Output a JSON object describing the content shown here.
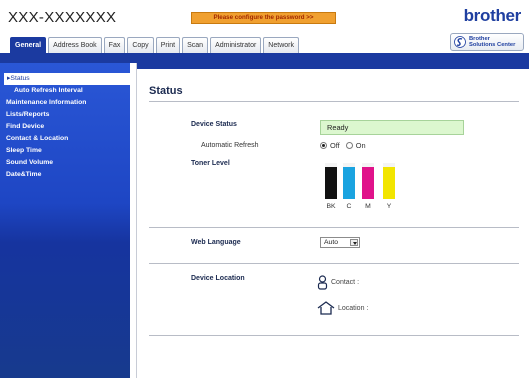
{
  "header": {
    "model": "XXX-XXXXXXX",
    "warning": "Please configure the password >>",
    "brand": "brother"
  },
  "tabs": [
    {
      "label": "General",
      "active": true
    },
    {
      "label": "Address Book",
      "active": false
    },
    {
      "label": "Fax",
      "active": false
    },
    {
      "label": "Copy",
      "active": false
    },
    {
      "label": "Print",
      "active": false
    },
    {
      "label": "Scan",
      "active": false
    },
    {
      "label": "Administrator",
      "active": false
    },
    {
      "label": "Network",
      "active": false
    }
  ],
  "solutions_center": {
    "line1": "Brother",
    "line2": "Solutions Center"
  },
  "sidebar": {
    "items": [
      {
        "label": "Status"
      },
      {
        "label": "Auto Refresh Interval"
      },
      {
        "label": "Maintenance Information"
      },
      {
        "label": "Lists/Reports"
      },
      {
        "label": "Find Device"
      },
      {
        "label": "Contact & Location"
      },
      {
        "label": "Sleep Time"
      },
      {
        "label": "Sound Volume"
      },
      {
        "label": "Date&Time"
      }
    ]
  },
  "main": {
    "title": "Status",
    "device_status_label": "Device Status",
    "device_status_value": "Ready",
    "auto_refresh_label": "Automatic Refresh",
    "auto_refresh_options": [
      "Off",
      "On"
    ],
    "auto_refresh_selected": "Off",
    "toner_label": "Toner Level",
    "toners": [
      {
        "label": "BK",
        "color": "#111111",
        "level": 0.9
      },
      {
        "label": "C",
        "color": "#1aa3e0",
        "level": 0.9
      },
      {
        "label": "M",
        "color": "#e0128a",
        "level": 0.9
      },
      {
        "label": "Y",
        "color": "#f2e500",
        "level": 0.9
      }
    ],
    "web_language_label": "Web Language",
    "web_language_value": "Auto",
    "device_location_label": "Device Location",
    "contact_label": "Contact :",
    "location_label": "Location :"
  },
  "colors": {
    "brand_blue": "#1b3aa0",
    "warning_orange": "#f0a030",
    "ready_green": "#dcf7cf"
  }
}
